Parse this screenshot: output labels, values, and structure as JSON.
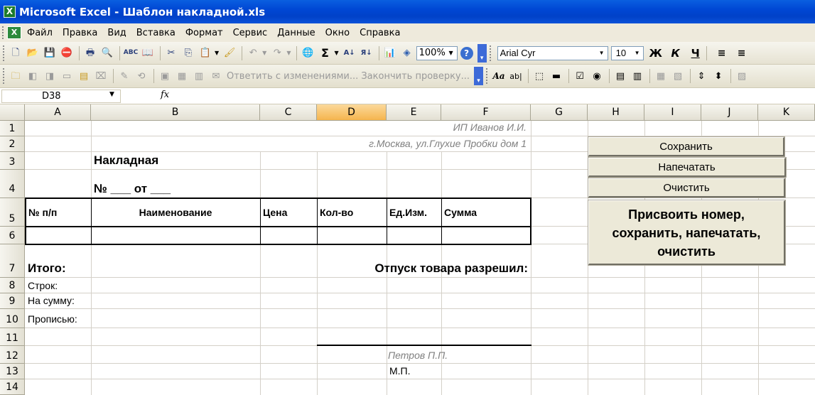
{
  "window": {
    "title": "Microsoft Excel - Шаблон накладной.xls",
    "app_icon": "X"
  },
  "menu": [
    "Файл",
    "Правка",
    "Вид",
    "Вставка",
    "Формат",
    "Сервис",
    "Данные",
    "Окно",
    "Справка"
  ],
  "toolbar": {
    "zoom": "100%",
    "font": "Arial Cyr",
    "font_size": "10",
    "bold": "Ж",
    "italic": "К",
    "underline": "Ч",
    "review_text": "Ответить с изменениями... Закончить проверку..."
  },
  "formula_bar": {
    "name_box": "D38",
    "fx": "fx",
    "content": ""
  },
  "columns": [
    "A",
    "B",
    "C",
    "D",
    "E",
    "F",
    "G",
    "H",
    "I",
    "J",
    "K"
  ],
  "rows": [
    "1",
    "2",
    "3",
    "4",
    "5",
    "6",
    "7",
    "8",
    "9",
    "10",
    "11",
    "12",
    "13",
    "14"
  ],
  "sheet": {
    "company": "ИП Иванов И.И.",
    "address": "г.Москва, ул.Глухие Пробки дом 1",
    "doc_title": "Накладная",
    "doc_number": "№ ___ от ___",
    "headers": [
      "№ п/п",
      "Наименование",
      "Цена",
      "Кол-во",
      "Ед.Изм.",
      "Сумма"
    ],
    "total_label": "Итого:",
    "release_label": "Отпуск товара разрешил:",
    "rows_label": "Строк:",
    "sum_label": "На сумму:",
    "words_label": "Прописью:",
    "signer": "Петров П.П.",
    "stamp": "М.П."
  },
  "buttons": {
    "save": "Сохранить",
    "print": "Напечатать",
    "clear": "Очистить",
    "combo_line1": "Присвоить номер,",
    "combo_line2": "сохранить, напечатать,",
    "combo_line3": "очистить"
  }
}
